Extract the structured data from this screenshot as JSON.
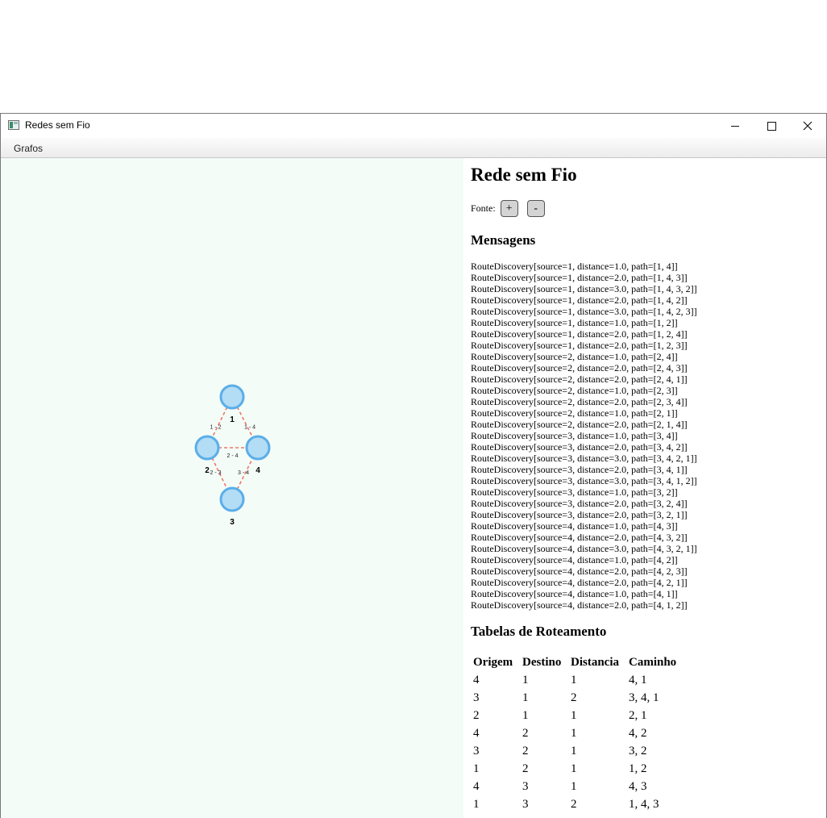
{
  "window": {
    "title": "Redes sem Fio"
  },
  "menu": {
    "items": [
      "Grafos"
    ]
  },
  "graph": {
    "nodes": [
      {
        "id": 1,
        "label": "1"
      },
      {
        "id": 2,
        "label": "2"
      },
      {
        "id": 3,
        "label": "3"
      },
      {
        "id": 4,
        "label": "4"
      }
    ],
    "edges": [
      {
        "from": 1,
        "to": 2,
        "label": "1 - 2"
      },
      {
        "from": 1,
        "to": 4,
        "label": "1 - 4"
      },
      {
        "from": 2,
        "to": 4,
        "label": "2 - 4"
      },
      {
        "from": 2,
        "to": 3,
        "label": "2 - 3"
      },
      {
        "from": 3,
        "to": 4,
        "label": "3 - 4"
      }
    ],
    "colors": {
      "node_fill": "#b3dcf5",
      "node_stroke": "#5aaee8",
      "edge": "#ee7766"
    }
  },
  "page": {
    "title": "Rede sem Fio",
    "font_label": "Fonte:",
    "font_plus": "+",
    "font_minus": "-",
    "messages_heading": "Mensagens",
    "messages": [
      "RouteDiscovery[source=1, distance=1.0, path=[1, 4]]",
      "RouteDiscovery[source=1, distance=2.0, path=[1, 4, 3]]",
      "RouteDiscovery[source=1, distance=3.0, path=[1, 4, 3, 2]]",
      "RouteDiscovery[source=1, distance=2.0, path=[1, 4, 2]]",
      "RouteDiscovery[source=1, distance=3.0, path=[1, 4, 2, 3]]",
      "RouteDiscovery[source=1, distance=1.0, path=[1, 2]]",
      "RouteDiscovery[source=1, distance=2.0, path=[1, 2, 4]]",
      "RouteDiscovery[source=1, distance=2.0, path=[1, 2, 3]]",
      "RouteDiscovery[source=2, distance=1.0, path=[2, 4]]",
      "RouteDiscovery[source=2, distance=2.0, path=[2, 4, 3]]",
      "RouteDiscovery[source=2, distance=2.0, path=[2, 4, 1]]",
      "RouteDiscovery[source=2, distance=1.0, path=[2, 3]]",
      "RouteDiscovery[source=2, distance=2.0, path=[2, 3, 4]]",
      "RouteDiscovery[source=2, distance=1.0, path=[2, 1]]",
      "RouteDiscovery[source=2, distance=2.0, path=[2, 1, 4]]",
      "RouteDiscovery[source=3, distance=1.0, path=[3, 4]]",
      "RouteDiscovery[source=3, distance=2.0, path=[3, 4, 2]]",
      "RouteDiscovery[source=3, distance=3.0, path=[3, 4, 2, 1]]",
      "RouteDiscovery[source=3, distance=2.0, path=[3, 4, 1]]",
      "RouteDiscovery[source=3, distance=3.0, path=[3, 4, 1, 2]]",
      "RouteDiscovery[source=3, distance=1.0, path=[3, 2]]",
      "RouteDiscovery[source=3, distance=2.0, path=[3, 2, 4]]",
      "RouteDiscovery[source=3, distance=2.0, path=[3, 2, 1]]",
      "RouteDiscovery[source=4, distance=1.0, path=[4, 3]]",
      "RouteDiscovery[source=4, distance=2.0, path=[4, 3, 2]]",
      "RouteDiscovery[source=4, distance=3.0, path=[4, 3, 2, 1]]",
      "RouteDiscovery[source=4, distance=1.0, path=[4, 2]]",
      "RouteDiscovery[source=4, distance=2.0, path=[4, 2, 3]]",
      "RouteDiscovery[source=4, distance=2.0, path=[4, 2, 1]]",
      "RouteDiscovery[source=4, distance=1.0, path=[4, 1]]",
      "RouteDiscovery[source=4, distance=2.0, path=[4, 1, 2]]"
    ],
    "tables_heading": "Tabelas de Roteamento",
    "table": {
      "headers": [
        "Origem",
        "Destino",
        "Distancia",
        "Caminho"
      ],
      "rows": [
        [
          "4",
          "1",
          "1",
          "4, 1"
        ],
        [
          "3",
          "1",
          "2",
          "3, 4, 1"
        ],
        [
          "2",
          "1",
          "1",
          "2, 1"
        ],
        [
          "4",
          "2",
          "1",
          "4, 2"
        ],
        [
          "3",
          "2",
          "1",
          "3, 2"
        ],
        [
          "1",
          "2",
          "1",
          "1, 2"
        ],
        [
          "4",
          "3",
          "1",
          "4, 3"
        ],
        [
          "1",
          "3",
          "2",
          "1, 4, 3"
        ]
      ]
    }
  }
}
